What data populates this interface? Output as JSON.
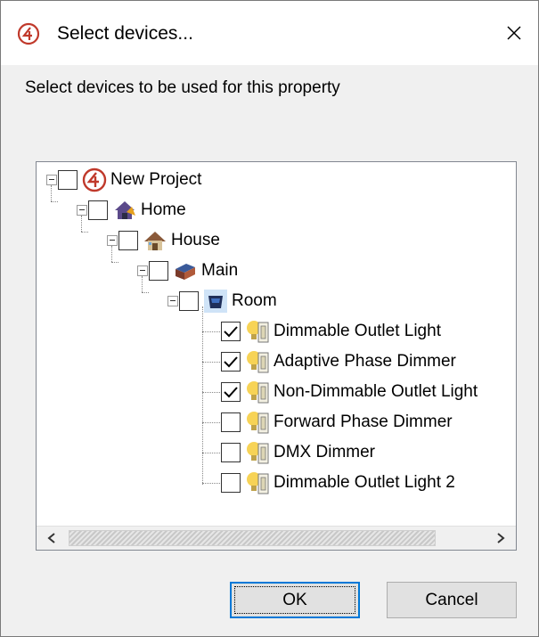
{
  "dialog": {
    "title": "Select devices...",
    "instruction": "Select devices to be used for this property"
  },
  "colors": {
    "accent": "#0078d7",
    "logo": "#c0392b"
  },
  "tree": {
    "root": {
      "label": "New Project",
      "checked": false,
      "icon": "control4-logo-icon"
    },
    "home": {
      "label": "Home",
      "checked": false,
      "icon": "home-icon"
    },
    "house": {
      "label": "House",
      "checked": false,
      "icon": "house-icon"
    },
    "main": {
      "label": "Main",
      "checked": false,
      "icon": "floor-icon"
    },
    "room": {
      "label": "Room",
      "checked": false,
      "icon": "room-icon"
    },
    "devices": [
      {
        "label": "Dimmable Outlet Light",
        "checked": true,
        "icon": "light-icon"
      },
      {
        "label": "Adaptive Phase Dimmer",
        "checked": true,
        "icon": "light-icon"
      },
      {
        "label": "Non-Dimmable Outlet Light",
        "checked": true,
        "icon": "light-icon"
      },
      {
        "label": "Forward Phase Dimmer",
        "checked": false,
        "icon": "light-icon"
      },
      {
        "label": "DMX Dimmer",
        "checked": false,
        "icon": "light-icon"
      },
      {
        "label": "Dimmable Outlet Light 2",
        "checked": false,
        "icon": "light-icon"
      }
    ]
  },
  "buttons": {
    "ok": "OK",
    "cancel": "Cancel"
  }
}
